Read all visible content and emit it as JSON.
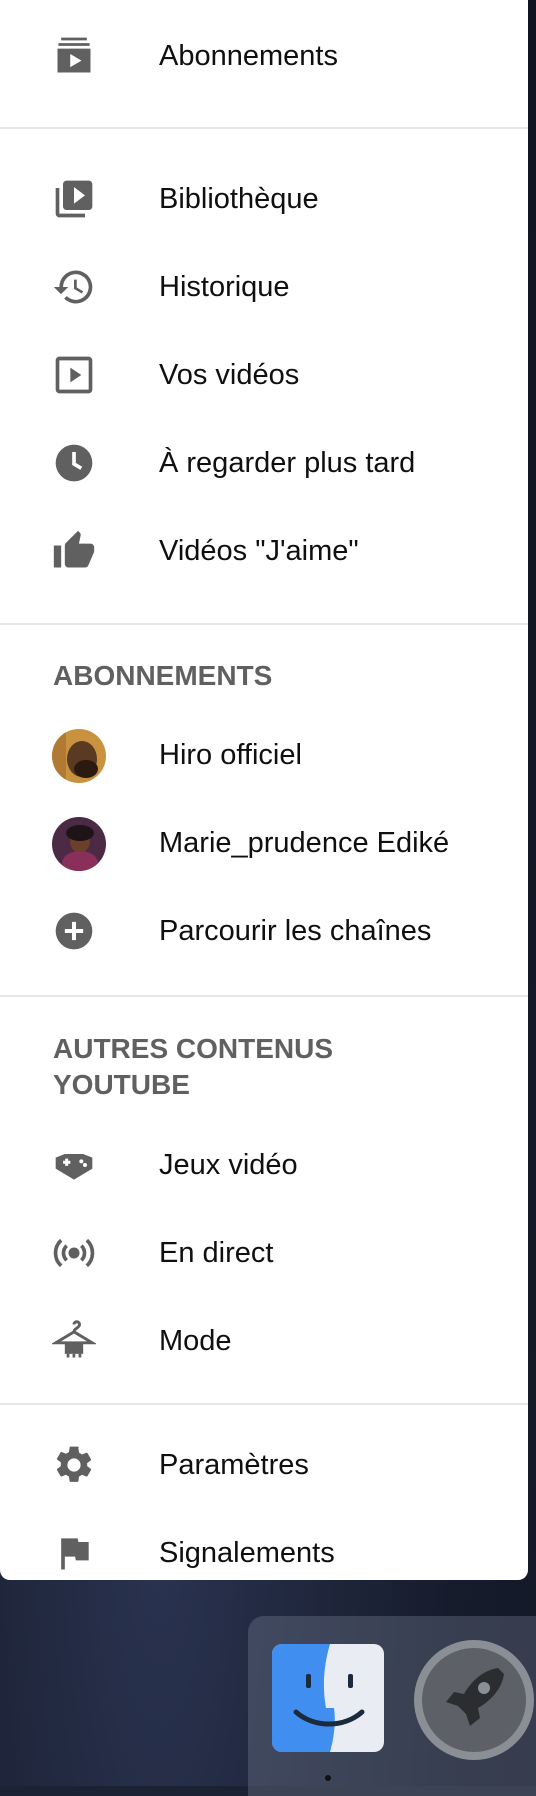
{
  "drawer": {
    "top_item": {
      "label": "Abonnements",
      "icon": "subscriptions-icon"
    },
    "library_items": [
      {
        "label": "Bibliothèque",
        "icon": "library-icon"
      },
      {
        "label": "Historique",
        "icon": "history-icon"
      },
      {
        "label": "Vos vidéos",
        "icon": "your-videos-icon"
      },
      {
        "label": "À regarder plus tard",
        "icon": "watch-later-icon"
      },
      {
        "label": "Vidéos \"J'aime\"",
        "icon": "liked-videos-icon"
      }
    ],
    "subscriptions": {
      "title": "ABONNEMENTS",
      "channels": [
        {
          "label": "Hiro officiel",
          "icon": "channel-avatar"
        },
        {
          "label": "Marie_prudence Ediké",
          "icon": "channel-avatar"
        }
      ],
      "browse": {
        "label": "Parcourir les chaînes",
        "icon": "add-circle-icon"
      }
    },
    "more": {
      "title": "AUTRES CONTENUS YOUTUBE",
      "items": [
        {
          "label": "Jeux vidéo",
          "icon": "gaming-icon"
        },
        {
          "label": "En direct",
          "icon": "live-icon"
        },
        {
          "label": "Mode",
          "icon": "fashion-hanger-icon"
        }
      ]
    },
    "footer_items": [
      {
        "label": "Paramètres",
        "icon": "settings-icon"
      },
      {
        "label": "Signalements",
        "icon": "flag-icon"
      }
    ]
  },
  "dock": {
    "apps": [
      {
        "name": "Finder",
        "icon": "finder-icon"
      },
      {
        "name": "Launchpad",
        "icon": "launchpad-icon"
      }
    ]
  },
  "colors": {
    "icon": "#606060",
    "text": "#0f0f0f",
    "section": "#606060",
    "divider": "#e5e5e5"
  }
}
